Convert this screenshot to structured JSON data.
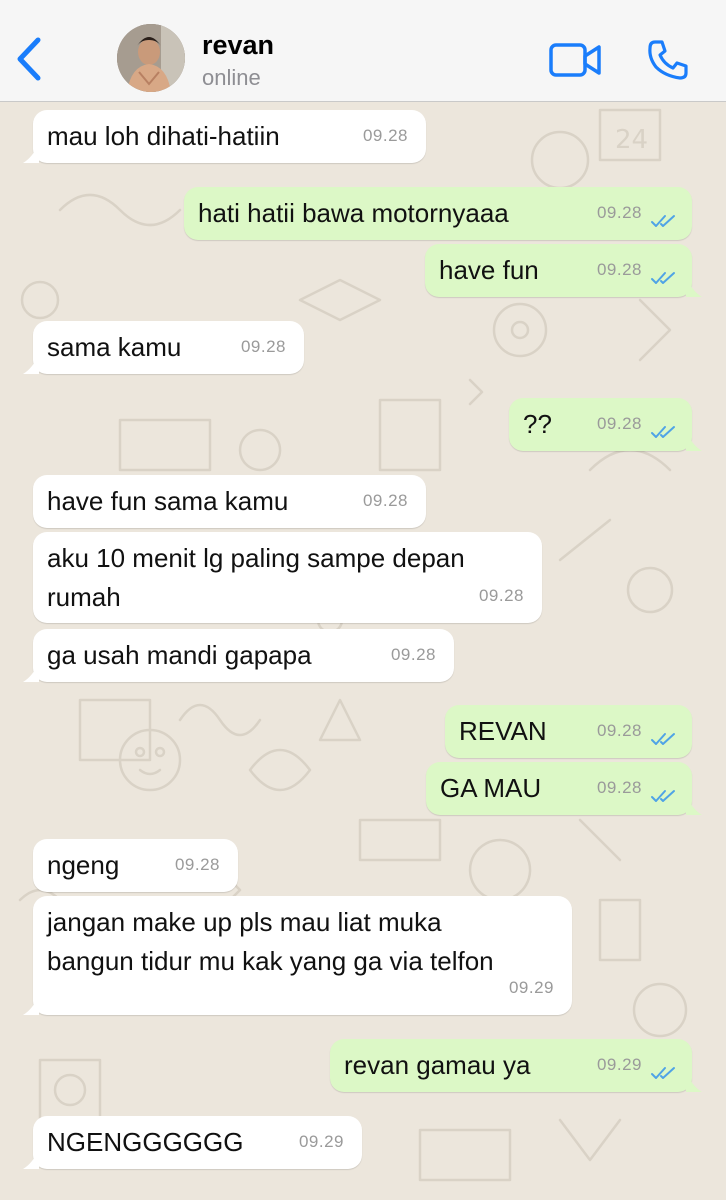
{
  "header": {
    "back_icon": "chevron-left-icon",
    "name": "revan",
    "status": "online",
    "video_icon": "video-camera-icon",
    "call_icon": "phone-icon"
  },
  "colors": {
    "accent": "#1a7dfb",
    "incoming_bubble": "#ffffff",
    "outgoing_bubble": "#dcf8c6",
    "read_ticks": "#4fa3e6",
    "background": "#ece6dc"
  },
  "messages": [
    {
      "dir": "in",
      "text": "mau loh dihati-hatiin",
      "time": "09.28"
    },
    {
      "dir": "out",
      "text": "hati hatii bawa motornyaaa",
      "time": "09.28",
      "status": "read"
    },
    {
      "dir": "out",
      "text": "have fun",
      "time": "09.28",
      "status": "read"
    },
    {
      "dir": "in",
      "text": "sama kamu",
      "time": "09.28"
    },
    {
      "dir": "out",
      "text": "??",
      "time": "09.28",
      "status": "read"
    },
    {
      "dir": "in",
      "text": "have fun sama kamu",
      "time": "09.28"
    },
    {
      "dir": "in",
      "text": "aku 10 menit lg paling sampe depan",
      "text2": "rumah",
      "time": "09.28"
    },
    {
      "dir": "in",
      "text": "ga usah mandi gapapa",
      "time": "09.28"
    },
    {
      "dir": "out",
      "text": "REVAN",
      "time": "09.28",
      "status": "read"
    },
    {
      "dir": "out",
      "text": "GA MAU",
      "time": "09.28",
      "status": "read"
    },
    {
      "dir": "in",
      "text": "ngeng",
      "time": "09.28"
    },
    {
      "dir": "in",
      "text": "jangan make up pls mau liat muka",
      "text2": "bangun tidur mu kak yang ga via telfon",
      "time": "09.29"
    },
    {
      "dir": "out",
      "text": "revan gamau ya",
      "time": "09.29",
      "status": "read"
    },
    {
      "dir": "in",
      "text": "NGENGGGGGG",
      "time": "09.29"
    }
  ]
}
